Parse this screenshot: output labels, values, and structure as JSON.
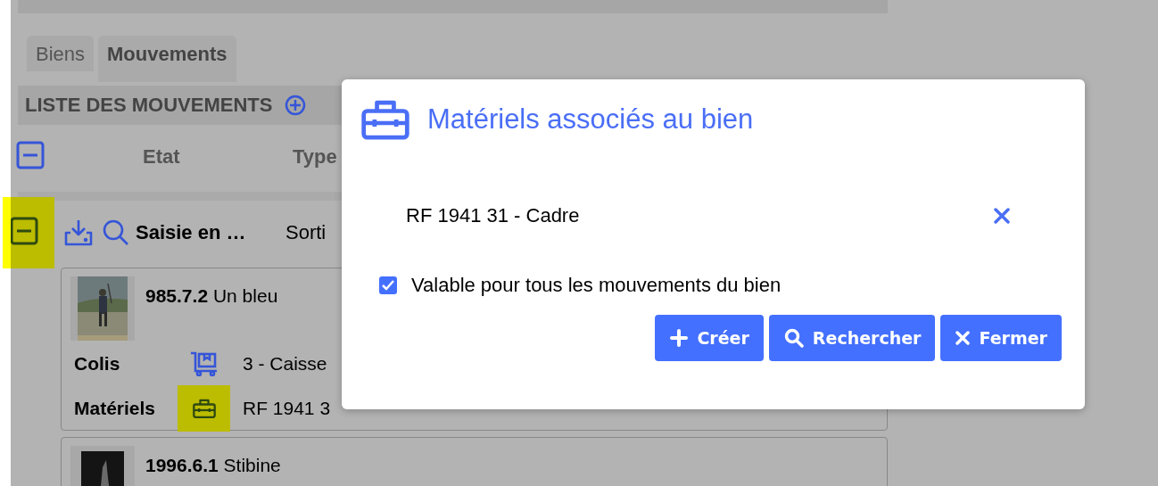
{
  "tabs": [
    {
      "label": "Biens",
      "selected": false
    },
    {
      "label": "Mouvements",
      "selected": true
    }
  ],
  "list_header": {
    "title": "LISTE DES MOUVEMENTS"
  },
  "columns": [
    "Etat",
    "Type"
  ],
  "columns_expanded": true,
  "movement": {
    "expanded": true,
    "highlighted": true,
    "etat": "Saisie en …",
    "type": "Sorti"
  },
  "items": [
    {
      "number": "985.7.2",
      "name": "Un bleu",
      "details": [
        {
          "kind": "colis",
          "label": "Colis",
          "value": "3 - Caisse",
          "highlighted": false
        },
        {
          "kind": "materiels",
          "label": "Matériels",
          "value": "RF 1941 3",
          "highlighted": true
        }
      ]
    },
    {
      "number": "1996.6.1",
      "name": "Stibine"
    }
  ],
  "dialog": {
    "title": "Matériels associés au bien",
    "materials": [
      {
        "label": "RF 1941 31 - Cadre"
      }
    ],
    "checkbox": {
      "label": "Valable pour tous les mouvements du bien",
      "checked": true
    },
    "buttons": [
      {
        "label": "Créer",
        "kind": "create"
      },
      {
        "label": "Rechercher",
        "kind": "search"
      },
      {
        "label": "Fermer",
        "kind": "close"
      }
    ]
  }
}
